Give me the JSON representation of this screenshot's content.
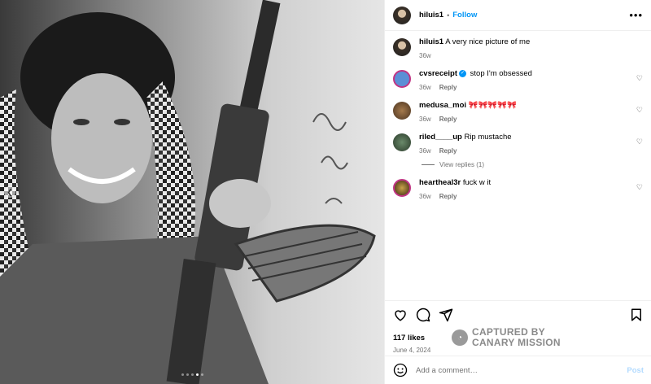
{
  "post": {
    "username": "hiluis1",
    "separator": "•",
    "follow_label": "Follow",
    "more_icon": "more-horizontal-icon",
    "likes": "117 likes",
    "date": "June 4, 2024",
    "media_count": 5,
    "active_media": 4
  },
  "caption": {
    "username": "hiluis1",
    "text": "A very nice picture of me",
    "time": "36w"
  },
  "comments": [
    {
      "username": "cvsreceipt",
      "verified": true,
      "text": "stop I'm obsessed",
      "time": "36w",
      "reply_label": "Reply"
    },
    {
      "username": "medusa_moi",
      "verified": false,
      "text": "🎀🎀🎀🎀🎀",
      "time": "36w",
      "reply_label": "Reply"
    },
    {
      "username": "riled____up",
      "verified": false,
      "text": "Rip mustache",
      "time": "36w",
      "reply_label": "Reply",
      "view_replies": "View replies (1)"
    },
    {
      "username": "heartheal3r",
      "verified": false,
      "text": "fuck w it",
      "time": "36w",
      "reply_label": "Reply"
    }
  ],
  "watermark": {
    "line1": "CAPTURED BY",
    "line2": "CANARY MISSION"
  },
  "composer": {
    "placeholder": "Add a comment…",
    "post_label": "Post"
  },
  "colors": {
    "accent": "#0095f6",
    "muted": "#737373",
    "post_disabled": "#b3dbff"
  }
}
